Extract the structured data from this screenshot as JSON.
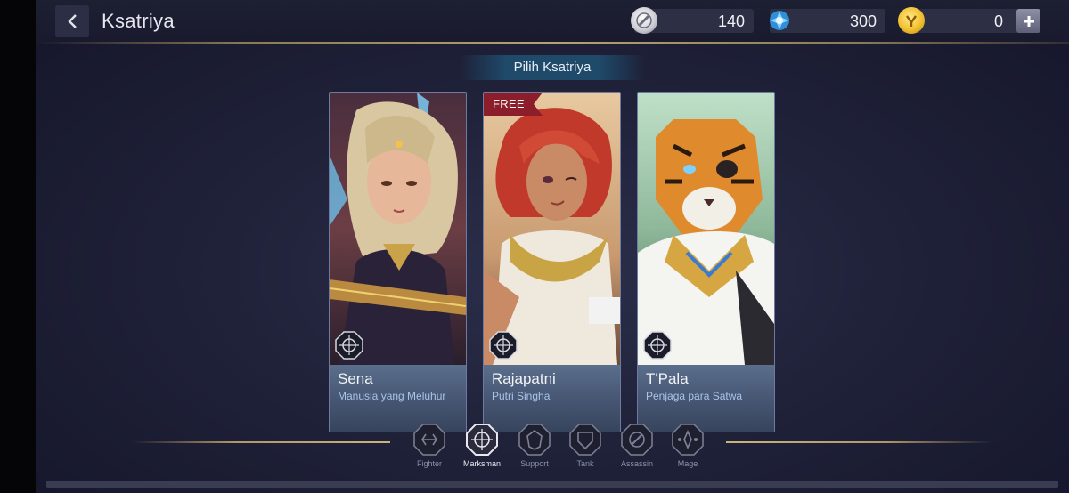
{
  "header": {
    "title": "Ksatriya",
    "currencies": [
      {
        "icon": "silver-coin-icon",
        "value": "140"
      },
      {
        "icon": "blue-gem-icon",
        "value": "300"
      },
      {
        "icon": "gold-voucher-icon",
        "value": "0"
      }
    ]
  },
  "section": {
    "title": "Pilih Ksatriya"
  },
  "heroes": [
    {
      "name": "Sena",
      "subtitle": "Manusia yang Meluhur",
      "free": false
    },
    {
      "name": "Rajapatni",
      "subtitle": "Putri Singha",
      "free": true,
      "badge": "FREE"
    },
    {
      "name": "T'Pala",
      "subtitle": "Penjaga para Satwa",
      "free": false
    }
  ],
  "roles": [
    {
      "label": "Fighter",
      "icon": "fighter-icon",
      "active": false
    },
    {
      "label": "Marksman",
      "icon": "marksman-icon",
      "active": true
    },
    {
      "label": "Support",
      "icon": "support-icon",
      "active": false
    },
    {
      "label": "Tank",
      "icon": "tank-icon",
      "active": false
    },
    {
      "label": "Assassin",
      "icon": "assassin-icon",
      "active": false
    },
    {
      "label": "Mage",
      "icon": "mage-icon",
      "active": false
    }
  ],
  "colors": {
    "accent_gold": "#b39663",
    "free_tag": "#8b1e2a",
    "card_info": "#4a5b78"
  }
}
